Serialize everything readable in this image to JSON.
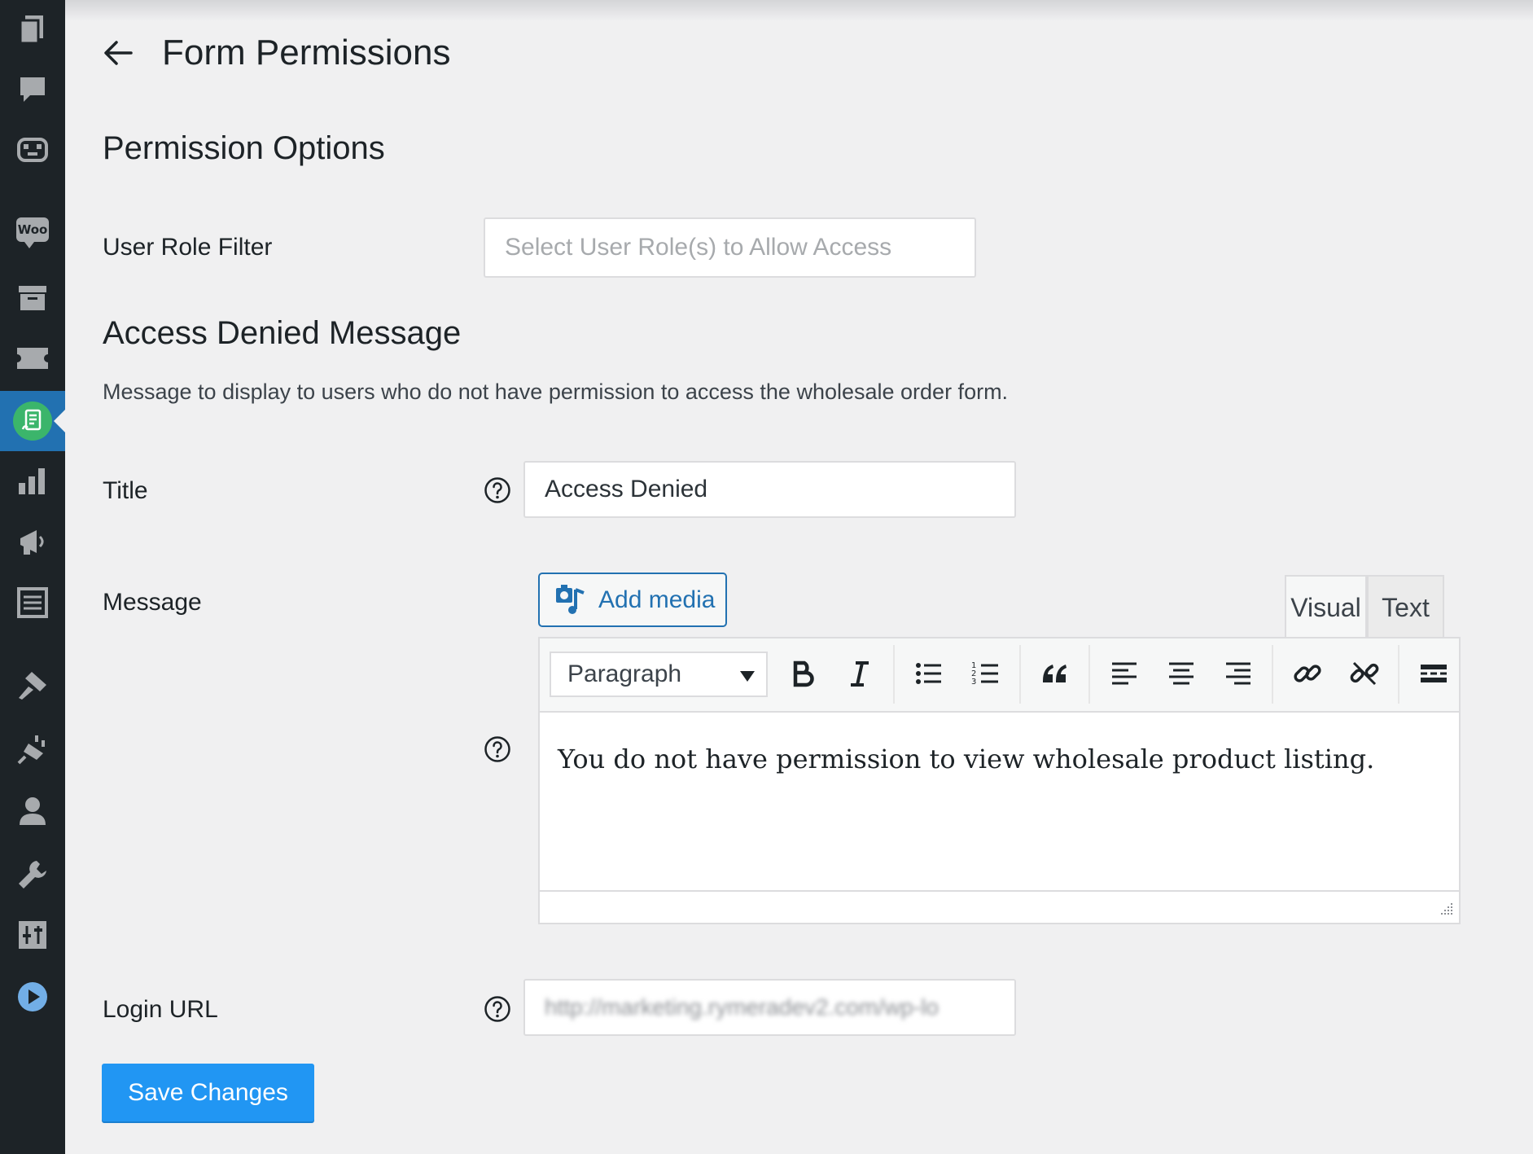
{
  "sidebar": {
    "icons": [
      "pages-icon",
      "comments-icon",
      "robot-icon",
      "woocommerce-icon",
      "archive-icon",
      "ticket-icon",
      "wholesale-order-form-icon",
      "analytics-icon",
      "marketing-icon",
      "form-list-icon",
      "appearance-icon",
      "plugins-icon",
      "users-icon",
      "tools-icon",
      "settings-icon",
      "play-icon"
    ],
    "woo_badge": "Woo",
    "active_color": "#2271b1",
    "badge_color": "#3bb56b"
  },
  "header": {
    "title": "Form Permissions"
  },
  "permission_options": {
    "heading": "Permission Options",
    "user_role_label": "User Role Filter",
    "user_role_placeholder": "Select User Role(s) to Allow Access"
  },
  "access_denied": {
    "heading": "Access Denied Message",
    "description": "Message to display to users who do not have permission to access the wholesale order form.",
    "title_label": "Title",
    "title_value": "Access Denied",
    "message_label": "Message",
    "add_media_label": "Add media",
    "tabs": {
      "visual": "Visual",
      "text": "Text"
    },
    "format_select": "Paragraph",
    "message_body": "You do not have permission to view wholesale product listing.",
    "login_label": "Login URL",
    "login_value": "http://marketing.rymeradev2.com/wp-lo"
  },
  "actions": {
    "save_label": "Save Changes",
    "save_color": "#2196f3"
  }
}
